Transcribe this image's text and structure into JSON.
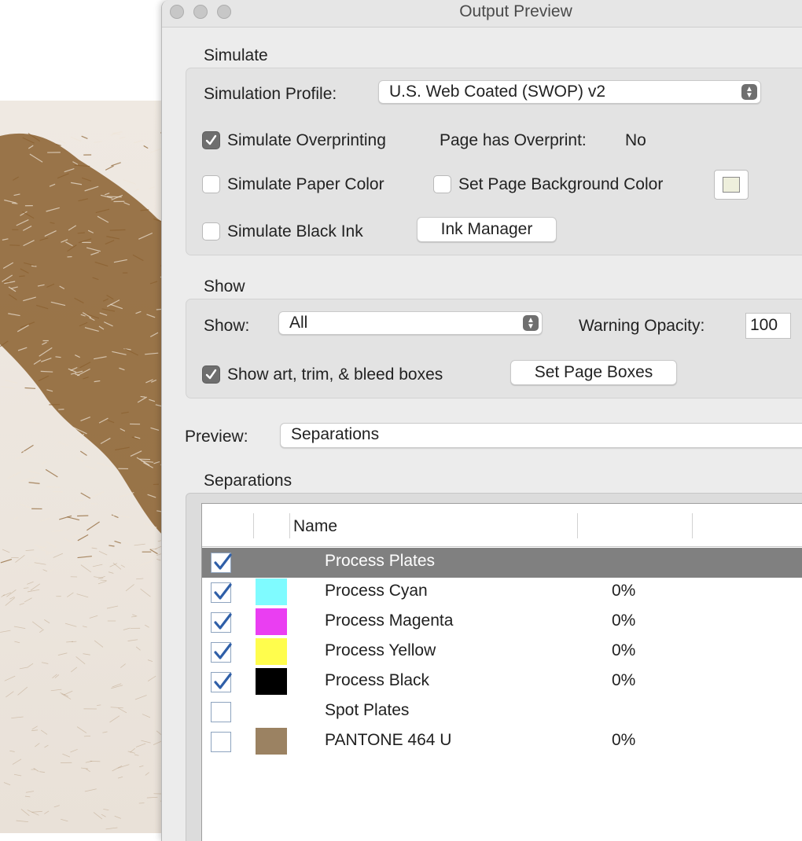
{
  "window": {
    "title": "Output Preview"
  },
  "simulate": {
    "section_title": "Simulate",
    "profile_label": "Simulation Profile:",
    "profile_value": "U.S. Web Coated (SWOP) v2",
    "overprint_label": "Simulate Overprinting",
    "overprint_checked": true,
    "page_overprint_label": "Page has Overprint:",
    "page_overprint_value": "No",
    "paper_color_label": "Simulate Paper Color",
    "paper_color_checked": false,
    "page_bg_label": "Set Page Background Color",
    "page_bg_checked": false,
    "page_bg_color": "#eeefdc",
    "black_ink_label": "Simulate Black Ink",
    "black_ink_checked": false,
    "ink_manager_button": "Ink Manager"
  },
  "show": {
    "section_title": "Show",
    "show_label": "Show:",
    "show_value": "All",
    "opacity_label": "Warning Opacity:",
    "opacity_value": "100",
    "boxes_label": "Show art, trim, & bleed boxes",
    "boxes_checked": true,
    "set_boxes_button": "Set Page Boxes"
  },
  "preview": {
    "label": "Preview:",
    "value": "Separations"
  },
  "separations": {
    "section_title": "Separations",
    "header_name": "Name",
    "rows": [
      {
        "name": "Process Plates",
        "checked": true,
        "swatch": null,
        "pct": "",
        "selected": true
      },
      {
        "name": "Process Cyan",
        "checked": true,
        "swatch": "#7ffbff",
        "pct": "0%",
        "selected": false
      },
      {
        "name": "Process Magenta",
        "checked": true,
        "swatch": "#ea3ef2",
        "pct": "0%",
        "selected": false
      },
      {
        "name": "Process Yellow",
        "checked": true,
        "swatch": "#fffd4d",
        "pct": "0%",
        "selected": false
      },
      {
        "name": "Process Black",
        "checked": true,
        "swatch": "#000000",
        "pct": "0%",
        "selected": false
      },
      {
        "name": "Spot Plates",
        "checked": false,
        "swatch": null,
        "pct": "",
        "selected": false
      },
      {
        "name": "PANTONE 464 U",
        "checked": false,
        "swatch": "#9b8262",
        "pct": "0%",
        "selected": false
      }
    ]
  },
  "document": {
    "ink_color": "#8a5f2e"
  }
}
